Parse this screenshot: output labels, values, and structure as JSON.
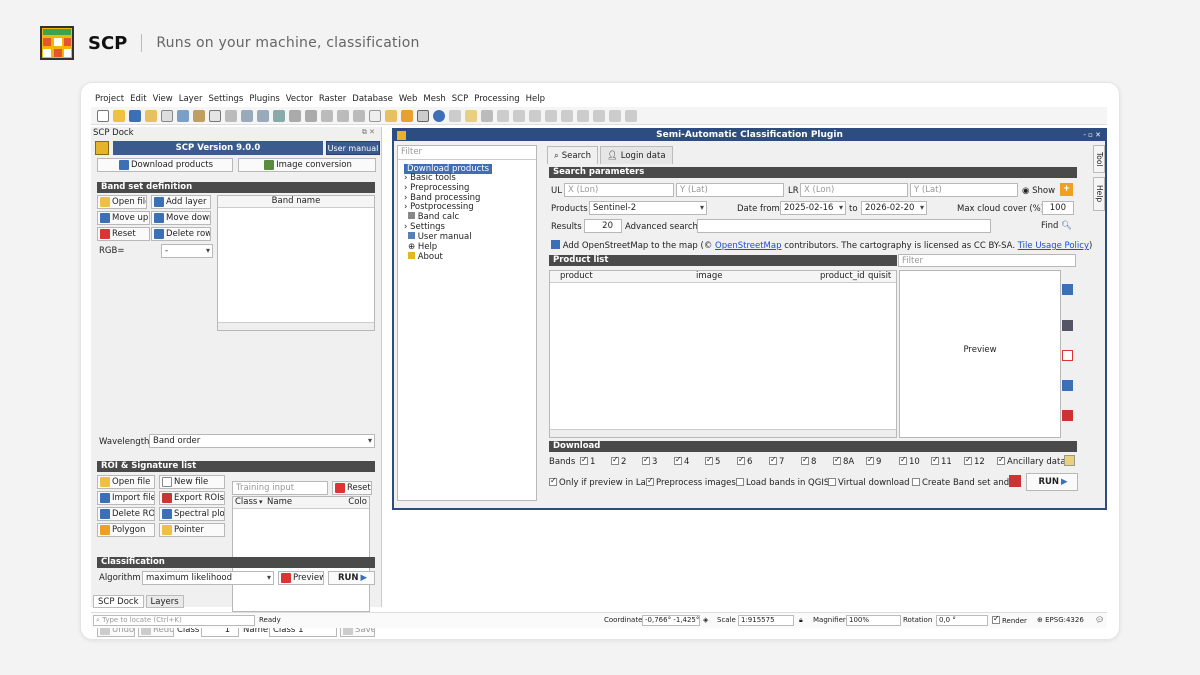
{
  "brand": {
    "name": "SCP",
    "subtitle": "Runs on your machine, classification"
  },
  "menu": [
    "Project",
    "Edit",
    "View",
    "Layer",
    "Settings",
    "Plugins",
    "Vector",
    "Raster",
    "Database",
    "Web",
    "Mesh",
    "SCP",
    "Processing",
    "Help"
  ],
  "dock": {
    "title": "SCP Dock",
    "version": "SCP Version 9.0.0",
    "user_manual": "User manual",
    "download_products": "Download products",
    "image_conversion": "Image conversion",
    "band_set": {
      "title": "Band set definition",
      "open_file": "Open file",
      "add_layer": "Add layer",
      "move_up": "Move up",
      "move_down": "Move down",
      "reset": "Reset",
      "delete_row": "Delete row",
      "rgb_label": "RGB=",
      "rgb_value": "-",
      "band_name_header": "Band name",
      "wavelength_label": "Wavelength",
      "wavelength_value": "Band order"
    },
    "roi": {
      "title": "ROI & Signature list",
      "open_file": "Open file",
      "new_file": "New file",
      "import_file": "Import file",
      "export_rois": "Export ROIs",
      "delete_roi": "Delete ROI",
      "spectral_plot": "Spectral plot",
      "polygon": "Polygon",
      "pointer": "Pointer",
      "training_input_placeholder": "Training input",
      "reset": "Reset",
      "col_class": "Class",
      "col_name": "Name",
      "col_color": "Colo",
      "undo": "Undo",
      "redo": "Redo",
      "class_label": "Class",
      "class_value": "1",
      "name_label": "Name",
      "name_value": "Class 1",
      "save": "Save"
    },
    "classification": {
      "title": "Classification",
      "algorithm_label": "Algorithm",
      "algorithm_value": "maximum likelihood",
      "preview": "Preview",
      "run": "RUN"
    },
    "tabs": [
      "SCP Dock",
      "Layers"
    ]
  },
  "status": {
    "locate_placeholder": "Type to locate (Ctrl+K)",
    "ready": "Ready",
    "coordinate_label": "Coordinate",
    "coordinate_value": "-0,766° -1,425°",
    "scale_label": "Scale",
    "scale_value": "1:915575",
    "magnifier_label": "Magnifier",
    "magnifier_value": "100%",
    "rotation_label": "Rotation",
    "rotation_value": "0,0 °",
    "render": "Render",
    "epsg": "EPSG:4326"
  },
  "plugin": {
    "title": "Semi-Automatic Classification Plugin",
    "filter_placeholder": "Filter",
    "tree": [
      {
        "label": "Download products",
        "selected": true
      },
      {
        "label": "Basic tools"
      },
      {
        "label": "Preprocessing"
      },
      {
        "label": "Band processing"
      },
      {
        "label": "Postprocessing"
      },
      {
        "label": "Band calc"
      },
      {
        "label": "Settings"
      },
      {
        "label": "User manual"
      },
      {
        "label": "Help"
      },
      {
        "label": "About"
      }
    ],
    "tabs": [
      "Search",
      "Login data"
    ],
    "side_tabs": [
      "Tool",
      "Help"
    ],
    "search": {
      "title": "Search parameters",
      "ul_label": "UL",
      "ul_x_placeholder": "X (Lon)",
      "ul_y_placeholder": "Y (Lat)",
      "lr_label": "LR",
      "lr_x_placeholder": "X (Lon)",
      "lr_y_placeholder": "Y (Lat)",
      "show": "Show",
      "products_label": "Products",
      "products_value": "Sentinel-2",
      "date_from_label": "Date from",
      "date_from_value": "2025-02-16",
      "to_label": "to",
      "date_to_value": "2026-02-20",
      "max_cloud_label": "Max cloud cover (%)",
      "max_cloud_value": "100",
      "results_label": "Results",
      "results_value": "20",
      "advanced_search": "Advanced search",
      "find": "Find",
      "osm_prefix": "Add OpenStreetMap to the map (©",
      "osm_link": "OpenStreetMap",
      "osm_middle": "contributors. The cartography is licensed as CC BY-SA.",
      "osm_policy": "Tile Usage Policy",
      "osm_suffix": ")"
    },
    "product_list": {
      "title": "Product list",
      "filter_placeholder": "Filter",
      "columns": [
        "product",
        "image",
        "product_id",
        "quisit"
      ],
      "preview": "Preview"
    },
    "download": {
      "title": "Download",
      "bands_label": "Bands",
      "bands": [
        "1",
        "2",
        "3",
        "4",
        "5",
        "6",
        "7",
        "8",
        "8A",
        "9",
        "10",
        "11",
        "12"
      ],
      "ancillary": "Ancillary data",
      "only_preview": "Only if preview in La",
      "preprocess": "Preprocess images",
      "load_bands": "Load bands in QGIS",
      "virtual": "Virtual download",
      "create_band_set": "Create Band set and",
      "run": "RUN"
    }
  }
}
